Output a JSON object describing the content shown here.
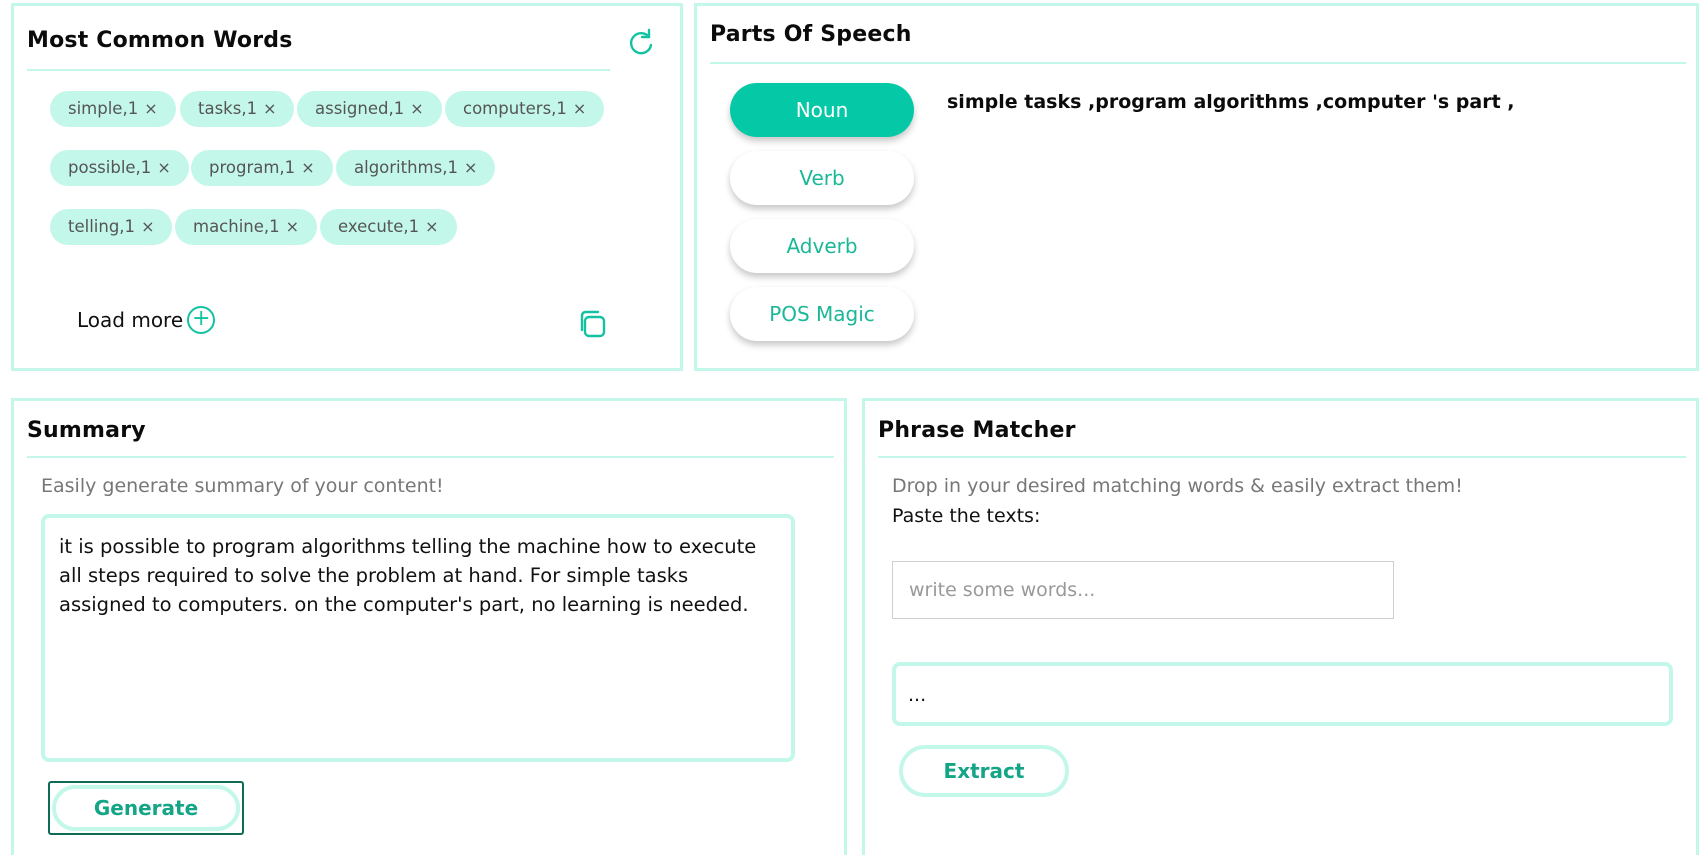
{
  "words_panel": {
    "title": "Most Common Words",
    "chips": [
      {
        "label": "simple,1"
      },
      {
        "label": "tasks,1"
      },
      {
        "label": "assigned,1"
      },
      {
        "label": "computers,1"
      },
      {
        "label": "possible,1"
      },
      {
        "label": "program,1"
      },
      {
        "label": "algorithms,1"
      },
      {
        "label": "telling,1"
      },
      {
        "label": "machine,1"
      },
      {
        "label": "execute,1"
      }
    ],
    "chip_remove_glyph": "×",
    "load_more_label": "Load more",
    "plus_glyph": "+",
    "icons": {
      "refresh": "refresh-icon",
      "copy": "copy-icon",
      "plus": "plus-circle-icon"
    }
  },
  "pos_panel": {
    "title": "Parts Of Speech",
    "buttons": [
      {
        "label": "Noun",
        "active": true
      },
      {
        "label": "Verb",
        "active": false
      },
      {
        "label": "Adverb",
        "active": false
      },
      {
        "label": "POS Magic",
        "active": false
      }
    ],
    "result": "simple tasks ,program algorithms ,computer 's part ,"
  },
  "summary_panel": {
    "title": "Summary",
    "subtitle": "Easily generate summary of your content!",
    "content": "it is possible to program algorithms telling the machine how to execute all steps required to solve the problem at hand. For simple tasks assigned to computers. on the computer's part, no learning is needed.",
    "generate_label": "Generate"
  },
  "phrase_panel": {
    "title": "Phrase Matcher",
    "subtitle": "Drop in your desired matching words & easily extract them!",
    "paste_label": "Paste the texts:",
    "words_placeholder": "write some words...",
    "text_value": "...",
    "extract_label": "Extract"
  },
  "colors": {
    "accent": "#05c9a6",
    "accent_text": "#14a587",
    "light": "#c3f7ea"
  }
}
